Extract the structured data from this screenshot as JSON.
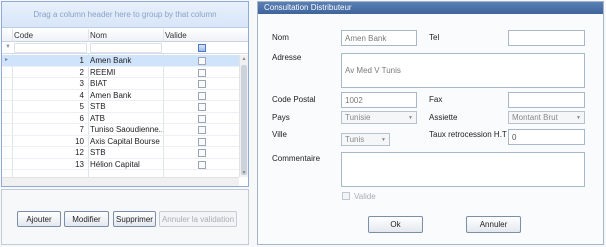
{
  "grid": {
    "group_hint": "Drag a column header here to group by that column",
    "columns": {
      "code": "Code",
      "nom": "Nom",
      "valide": "Valide"
    },
    "rows": [
      {
        "code": "1",
        "nom": "Amen Bank",
        "selected": true
      },
      {
        "code": "2",
        "nom": "REEMI"
      },
      {
        "code": "3",
        "nom": "BIAT"
      },
      {
        "code": "4",
        "nom": "Amen Bank"
      },
      {
        "code": "5",
        "nom": "STB"
      },
      {
        "code": "6",
        "nom": "ATB"
      },
      {
        "code": "7",
        "nom": "Tuniso Saoudienne..."
      },
      {
        "code": "10",
        "nom": "Axis Capital Bourse"
      },
      {
        "code": "12",
        "nom": "STB"
      },
      {
        "code": "13",
        "nom": "Hélion Capital"
      }
    ]
  },
  "actions": {
    "ajouter": "Ajouter",
    "modifier": "Modifier",
    "supprimer": "Supprimer",
    "annuler_validation": "Annuler la validation"
  },
  "form": {
    "title": "Consultation Distributeur",
    "nom_label": "Nom",
    "nom_value": "Amen Bank",
    "tel_label": "Tel",
    "tel_value": "",
    "adresse_label": "Adresse",
    "adresse_value": "Av Med V Tunis",
    "code_postal_label": "Code Postal",
    "code_postal_value": "1002",
    "fax_label": "Fax",
    "fax_value": "",
    "pays_label": "Pays",
    "pays_value": "Tunisie",
    "assiette_label": "Assiette",
    "assiette_value": "Montant  Brut",
    "ville_label": "Ville",
    "ville_value": "Tunis",
    "taux_label": "Taux retrocession H.T",
    "taux_value": "0",
    "commentaire_label": "Commentaire",
    "commentaire_value": "",
    "valide_label": "Valide",
    "ok": "Ok",
    "annuler": "Annuler"
  },
  "colors": {
    "title_bar": "#4a70a8",
    "selection": "#cfe3fb",
    "grid_border": "#8faad9"
  }
}
